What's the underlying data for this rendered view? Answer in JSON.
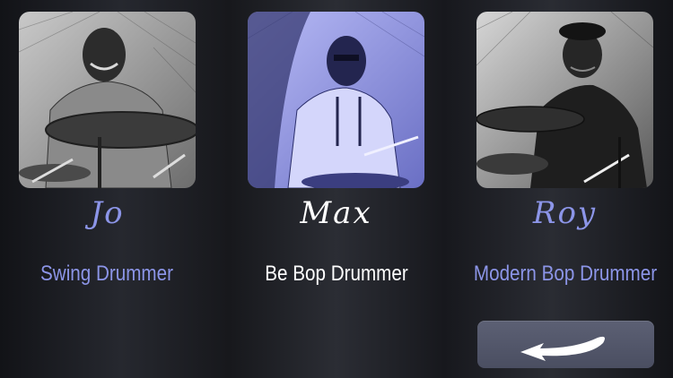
{
  "drummers": [
    {
      "signature": "Jo",
      "role": "Swing Drummer"
    },
    {
      "signature": "Max",
      "role": "Be Bop Drummer"
    },
    {
      "signature": "Roy",
      "role": "Modern Bop Drummer"
    }
  ],
  "selected_index": 1,
  "back_button": {
    "icon": "back-arrow-icon"
  },
  "colors": {
    "accent": "#8c95e8",
    "selected_text": "#ffffff",
    "selected_tint": "#9ea2f2",
    "button": "#555a6d"
  }
}
